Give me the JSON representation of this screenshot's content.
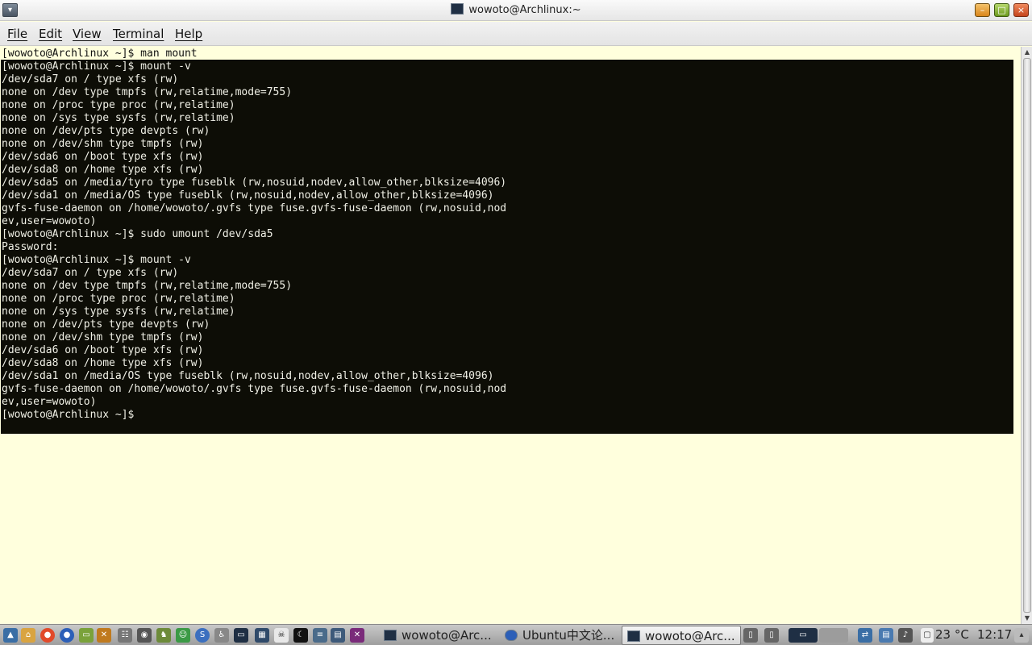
{
  "window": {
    "title": "wowoto@Archlinux:~",
    "menu_icon": "window-menu-icon",
    "buttons": {
      "minimize": "minimize-icon",
      "maximize": "maximize-icon",
      "close": "close-icon"
    }
  },
  "menubar": {
    "file": "File",
    "edit": "Edit",
    "view": "View",
    "terminal": "Terminal",
    "help": "Help"
  },
  "terminal": {
    "first_line": "[wowoto@Archlinux ~]$ man mount",
    "dark_lines": [
      "[wowoto@Archlinux ~]$ mount -v",
      "/dev/sda7 on / type xfs (rw)",
      "none on /dev type tmpfs (rw,relatime,mode=755)",
      "none on /proc type proc (rw,relatime)",
      "none on /sys type sysfs (rw,relatime)",
      "none on /dev/pts type devpts (rw)",
      "none on /dev/shm type tmpfs (rw)",
      "/dev/sda6 on /boot type xfs (rw)",
      "/dev/sda8 on /home type xfs (rw)",
      "/dev/sda5 on /media/tyro type fuseblk (rw,nosuid,nodev,allow_other,blksize=4096)",
      "/dev/sda1 on /media/OS type fuseblk (rw,nosuid,nodev,allow_other,blksize=4096)",
      "gvfs-fuse-daemon on /home/wowoto/.gvfs type fuse.gvfs-fuse-daemon (rw,nosuid,nod",
      "ev,user=wowoto)",
      "[wowoto@Archlinux ~]$ sudo umount /dev/sda5",
      "Password:",
      "[wowoto@Archlinux ~]$ mount -v",
      "/dev/sda7 on / type xfs (rw)",
      "none on /dev type tmpfs (rw,relatime,mode=755)",
      "none on /proc type proc (rw,relatime)",
      "none on /sys type sysfs (rw,relatime)",
      "none on /dev/pts type devpts (rw)",
      "none on /dev/shm type tmpfs (rw)",
      "/dev/sda6 on /boot type xfs (rw)",
      "/dev/sda8 on /home type xfs (rw)",
      "/dev/sda1 on /media/OS type fuseblk (rw,nosuid,nodev,allow_other,blksize=4096)",
      "gvfs-fuse-daemon on /home/wowoto/.gvfs type fuse.gvfs-fuse-daemon (rw,nosuid,nod",
      "ev,user=wowoto)",
      "[wowoto@Archlinux ~]$"
    ]
  },
  "taskbar": {
    "tasks": [
      {
        "label": "wowoto@Arc...",
        "icon": "terminal-icon"
      },
      {
        "label": "Ubuntu中文论...",
        "icon": "browser-icon"
      },
      {
        "label": "wowoto@Arc...",
        "icon": "terminal-icon",
        "active": true
      }
    ],
    "temperature": "23 °C",
    "clock": "12:17"
  }
}
